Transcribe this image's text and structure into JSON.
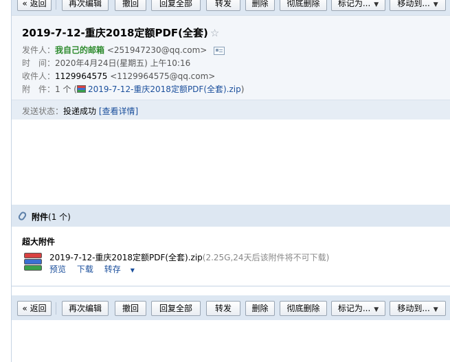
{
  "toolbar": {
    "back": "« 返回",
    "edit_again": "再次编辑",
    "recall": "撤回",
    "reply_all": "回复全部",
    "forward": "转发",
    "delete": "删除",
    "delete_permanent": "彻底删除",
    "mark_as": "标记为...",
    "move_to": "移动到...",
    "dropdown_arrow": "▼"
  },
  "mail": {
    "subject": "2019-7-12-重庆2018定额PDF(全套)",
    "star": "☆",
    "sender_label": "发件人：",
    "sender_name": "我自己的邮箱",
    "sender_addr": "<251947230@qq.com>",
    "time_label": "时　间：",
    "time_value": "2020年4月24日(星期五) 上午10:16",
    "recipient_label": "收件人：",
    "recipient_name": "1129964575",
    "recipient_addr": "<1129964575@qq.com>",
    "attachment_label": "附　件：",
    "attachment_count": "1 个 (",
    "attachment_name": "2019-7-12-重庆2018定额PDF(全套).zip",
    "attachment_close": ")",
    "status_label": "发送状态：",
    "status_value": "投递成功",
    "status_link": "[查看详情]"
  },
  "attachments": {
    "title": "附件",
    "count": "(1 个)",
    "section_label": "超大附件",
    "file_name": "2019-7-12-重庆2018定额PDF(全套).zip",
    "file_note": "(2.25G,24天后该附件将不可下载)",
    "preview": "预览",
    "download": "下载",
    "save_to": "转存",
    "save_to_arrow": "▼"
  },
  "colors": {
    "toolbar_bg": "#dde7f2",
    "header_bg": "#f3f6fa",
    "sender_name": "#2e8b2e",
    "link": "#1b4f9c"
  }
}
